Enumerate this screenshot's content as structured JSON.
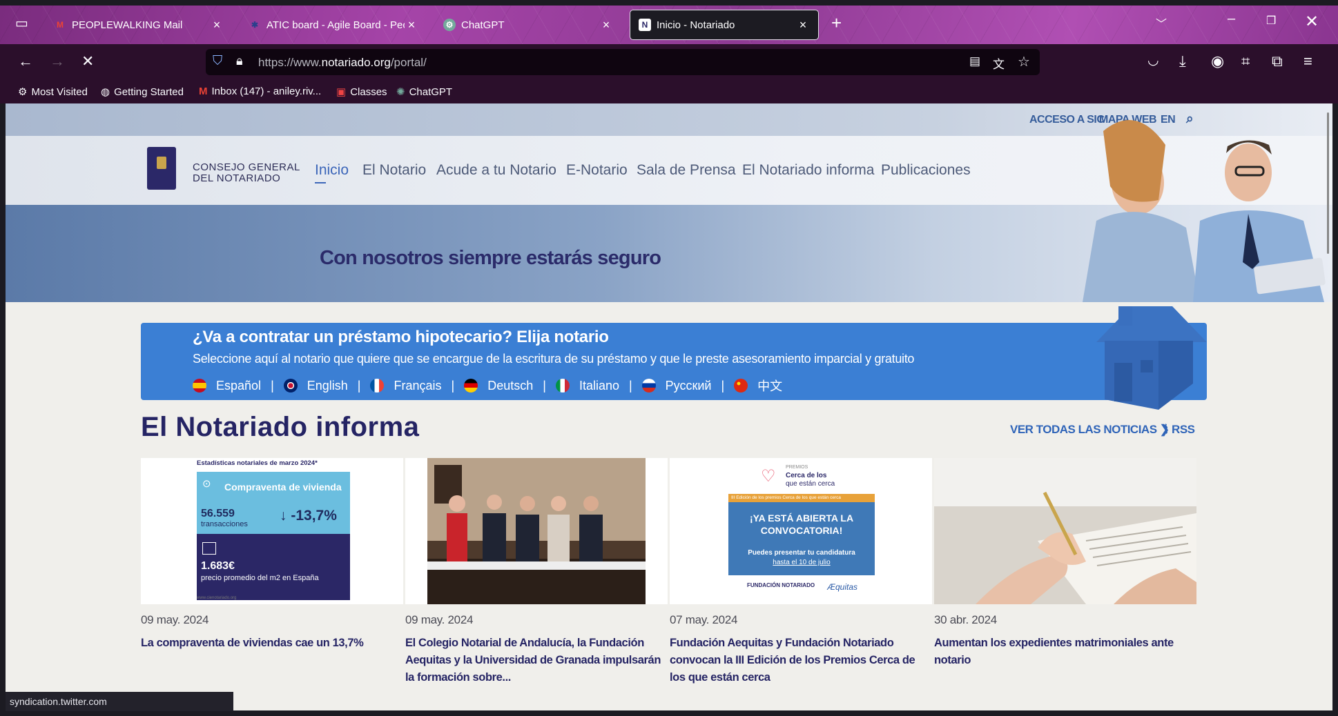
{
  "tabs": [
    {
      "label": "PEOPLEWALKING Mail",
      "icon": "gmail-icon"
    },
    {
      "label": "ATIC board - Agile Board - People",
      "icon": "jira-icon"
    },
    {
      "label": "ChatGPT",
      "icon": "chatgpt-icon"
    },
    {
      "label": "Inicio - Notariado",
      "icon": "notariado-icon",
      "active": true
    }
  ],
  "url": {
    "prefix": "https://www.",
    "domain": "notariado.org",
    "path": "/portal/"
  },
  "bookmarks": [
    {
      "label": "Most Visited",
      "icon": "gear-icon"
    },
    {
      "label": "Getting Started",
      "icon": "globe-icon"
    },
    {
      "label": "Inbox (147) - aniley.riv...",
      "icon": "gmail-icon"
    },
    {
      "label": "Classes",
      "icon": "classes-icon"
    },
    {
      "label": "ChatGPT",
      "icon": "chatgpt-icon"
    }
  ],
  "site": {
    "toplinks": [
      "ACCESO A SIC",
      "MAPA WEB",
      "EN"
    ],
    "logo_text": [
      "CONSEJO GENERAL",
      "DEL NOTARIADO"
    ],
    "nav": [
      "Inicio",
      "El Notario",
      "Acude a tu Notario",
      "E-Notario",
      "Sala de Prensa",
      "El Notariado informa",
      "Publicaciones"
    ],
    "slogan": "Con nosotros siempre estarás seguro",
    "banner": {
      "title": "¿Va a contratar un préstamo hipotecario? Elija notario",
      "subtitle": "Seleccione aquí al notario que quiere que se encargue de la escritura de su préstamo y que le preste asesoramiento imparcial y gratuito",
      "languages": [
        "Español",
        "English",
        "Français",
        "Deutsch",
        "Italiano",
        "Русский",
        "中文"
      ]
    },
    "news_title": "El Notariado informa",
    "news_all": "VER TODAS LAS NOTICIAS",
    "rss": "RSS",
    "news": [
      {
        "date": "09 may. 2024",
        "title": "La compraventa de viviendas cae un 13,7%"
      },
      {
        "date": "09 may. 2024",
        "title": "El Colegio Notarial de Andalucía, la Fundación Aequitas y la Universidad de Granada impulsarán la formación sobre..."
      },
      {
        "date": "07 may. 2024",
        "title": "Fundación Aequitas y Fundación Notariado convocan la III Edición de los Premios Cerca de los que están cerca"
      },
      {
        "date": "30 abr. 2024",
        "title": "Aumentan los expedientes matrimoniales ante notario"
      }
    ],
    "card1": {
      "heading": "Estadísticas notariales de marzo 2024*",
      "box": "Compraventa de vivienda",
      "num": "56.559",
      "numlabel": "transacciones",
      "pct": "-13,7%",
      "price": "1.683€",
      "pricelabel": "precio promedio del m2 en España",
      "site": "www.cienotariado.org"
    },
    "card3": {
      "premios": "PREMIOS",
      "cerca1": "Cerca de los",
      "cerca2": "que están cerca",
      "edicion": "III Edición de los premios Cerca de los que están cerca",
      "abierta": "¡YA ESTÁ ABIERTA LA CONVOCATORIA!",
      "puedes": "Puedes presentar tu candidatura",
      "hasta": "hasta el 10 de julio",
      "fundacion": "FUNDACIÓN NOTARIADO",
      "aequitas": "Æquitas"
    }
  },
  "status": "syndication.twitter.com"
}
